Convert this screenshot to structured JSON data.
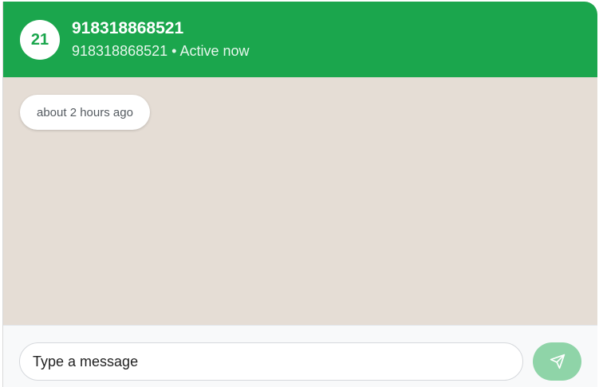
{
  "header": {
    "avatar_text": "21",
    "contact_name": "918318868521",
    "contact_status": "918318868521 • Active now"
  },
  "messages": {
    "timestamp_pill": "about 2 hours ago"
  },
  "composer": {
    "input_value": "",
    "input_placeholder": "Type a message",
    "send_icon": "send-icon"
  },
  "colors": {
    "header_green": "#1ba64d",
    "chat_background": "#e5ddd5",
    "send_button_disabled": "#8fd4a8"
  }
}
